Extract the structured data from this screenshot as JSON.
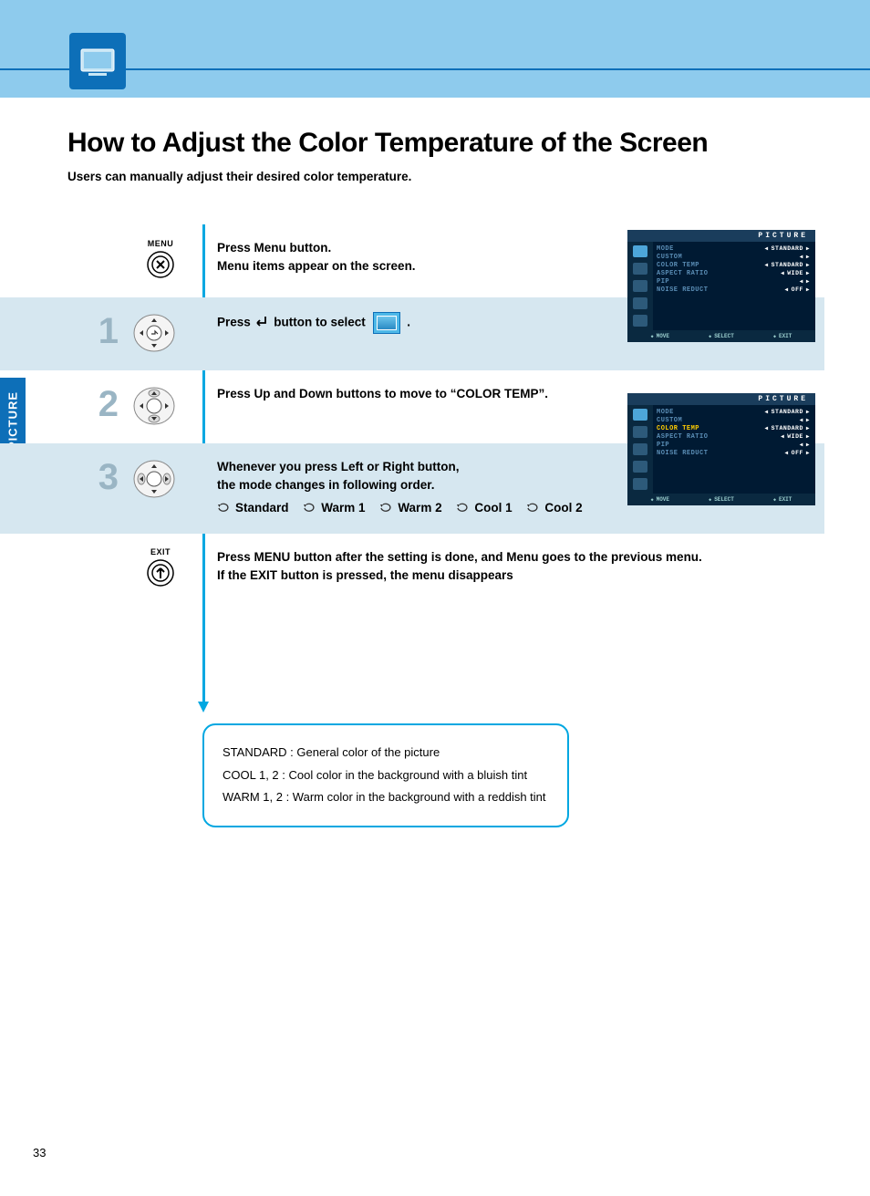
{
  "sideTab": "PICTURE",
  "title": "How to Adjust the Color Temperature of the  Screen",
  "subtitle": "Users can manually adjust their desired color temperature.",
  "menuLabel": "MENU",
  "exitLabel": "EXIT",
  "steps": {
    "menu": {
      "line1": "Press Menu button.",
      "line2": "Menu items appear on the screen."
    },
    "s1": {
      "num": "1",
      "prefix": "Press ",
      "suffix": " button to select ",
      "tail": " ."
    },
    "s2": {
      "num": "2",
      "text": "Press Up and Down buttons to move to “COLOR TEMP”."
    },
    "s3": {
      "num": "3",
      "line1": "Whenever you press Left or Right button,",
      "line2": "the mode changes in following order.",
      "modes": [
        "Standard",
        "Warm 1",
        "Warm 2",
        "Cool 1",
        "Cool 2"
      ]
    },
    "exit": {
      "line1": "Press MENU button after the setting is done, and Menu goes to the previous menu.",
      "line2": "If the EXIT button is pressed, the menu disappears"
    }
  },
  "info": {
    "l1": "STANDARD : General color of the picture",
    "l2": "COOL 1, 2 : Cool color in the background with a bluish tint",
    "l3": "WARM 1, 2 : Warm color in the background with a reddish tint"
  },
  "osd": {
    "title": "PICTURE",
    "rows": [
      {
        "label": "MODE",
        "val": "STANDARD"
      },
      {
        "label": "CUSTOM",
        "val": ""
      },
      {
        "label": "COLOR TEMP",
        "val": "STANDARD"
      },
      {
        "label": "ASPECT RATIO",
        "val": "WIDE"
      },
      {
        "label": "PIP",
        "val": ""
      },
      {
        "label": "NOISE REDUCT",
        "val": "OFF"
      }
    ],
    "foot": {
      "a": "MOVE",
      "b": "SELECT",
      "c": "EXIT"
    },
    "highlight2": 2
  },
  "pageNum": "33"
}
